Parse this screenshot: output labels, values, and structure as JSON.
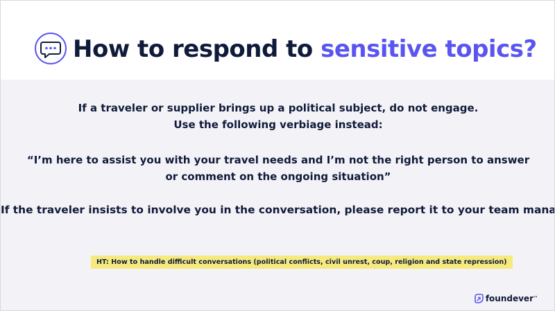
{
  "header": {
    "title_main": "How to respond to ",
    "title_accent": "sensitive topics?",
    "icon": "chat-bubble-icon"
  },
  "body": {
    "paragraph1": [
      "If a traveler or supplier brings up a political subject, do not engage.",
      "Use the following verbiage instead:"
    ],
    "quote": [
      "“I’m here to assist you with your travel needs and I’m not the right person to answer",
      "or comment on the ongoing situation”"
    ],
    "paragraph2": "If the traveler insists to involve you in the conversation, please report it to your team manager",
    "highlight_note": "HT: How to handle difficult conversations (political conflicts, civil unrest, coup, religion and state repression)"
  },
  "footer": {
    "brand_name": "foundever",
    "brand_mark": "™",
    "brand_icon": "foundever-logo-icon"
  },
  "colors": {
    "title": "#101a3a",
    "accent": "#5a55f0",
    "body_background": "#f3f3f7",
    "highlight": "#f6ea7f"
  }
}
